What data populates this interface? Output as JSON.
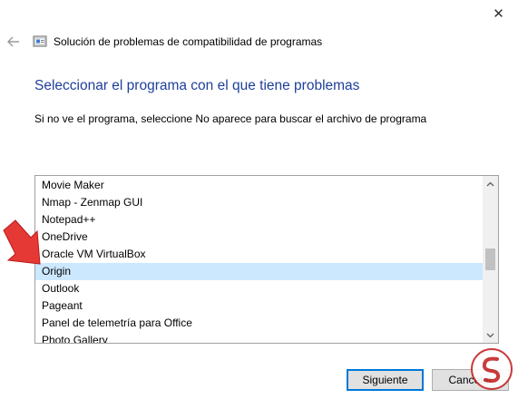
{
  "window": {
    "close_glyph": "✕"
  },
  "header": {
    "back_icon": "back-arrow-icon",
    "app_icon": "compatibility-troubleshooter-icon",
    "title": "Solución de problemas de compatibilidad de programas"
  },
  "main": {
    "heading": "Seleccionar el programa con el que tiene problemas",
    "instruction": "Si no ve el programa, seleccione No aparece para buscar el archivo de programa",
    "programs": [
      "Movie Maker",
      "Nmap - Zenmap GUI",
      "Notepad++",
      "OneDrive",
      "Oracle VM VirtualBox",
      "Origin",
      "Outlook",
      "Pageant",
      "Panel de telemetría para Office",
      "Photo Gallery"
    ],
    "selected_program": "Origin"
  },
  "footer": {
    "next_label": "Siguiente",
    "cancel_label": "Cancelar"
  },
  "colors": {
    "heading": "#1f3f9b",
    "selection": "#cce8ff",
    "primary_border": "#0078d7",
    "annotation_arrow": "#e53935"
  }
}
